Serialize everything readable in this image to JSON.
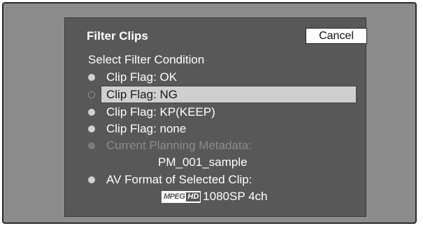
{
  "dialog": {
    "title": "Filter Clips",
    "cancel_label": "Cancel",
    "heading": "Select Filter Condition",
    "options": [
      {
        "label": "Clip Flag: OK"
      },
      {
        "label": "Clip Flag: NG",
        "selected": true
      },
      {
        "label": "Clip Flag: KP(KEEP)"
      },
      {
        "label": "Clip Flag: none"
      },
      {
        "label": "Current Planning Metadata:",
        "disabled": true,
        "value": "PM_001_sample"
      },
      {
        "label": "AV Format of Selected Clip:",
        "value": "1080SP 4ch"
      }
    ],
    "format_logo": {
      "left": "MPEG",
      "right": "HD"
    }
  },
  "colors": {
    "frame_bg": "#8c8c8c",
    "dialog_bg": "#585858",
    "selection": "#cfcfcf",
    "text": "#ffffff",
    "disabled_text": "#8c8c8c"
  }
}
